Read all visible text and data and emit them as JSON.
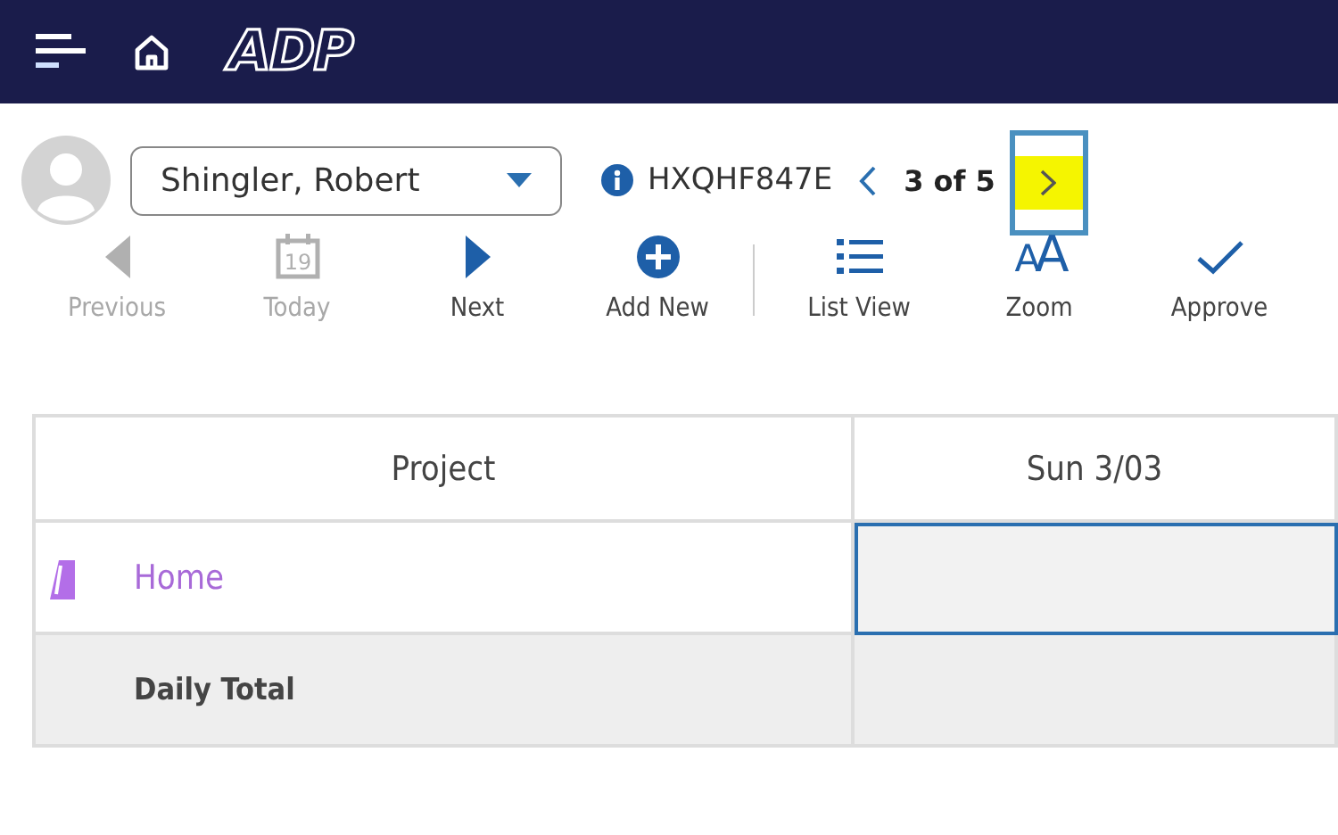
{
  "header": {
    "logo": "ADP"
  },
  "employee": {
    "name": "Shingler, Robert",
    "record_id": "HXQHF847E",
    "position": "3 of 5",
    "next_highlighted": true
  },
  "toolbar": {
    "groups": [
      [
        {
          "label": "Previous",
          "disabled": true
        },
        {
          "label": "Today",
          "disabled": true,
          "icon_text": "19"
        },
        {
          "label": "Next",
          "disabled": false
        },
        {
          "label": "Add New",
          "disabled": false
        }
      ],
      [
        {
          "label": "List View",
          "disabled": false
        },
        {
          "label": "Zoom",
          "disabled": false,
          "icon_text": "AA"
        },
        {
          "label": "Approve",
          "disabled": false
        }
      ]
    ]
  },
  "table": {
    "columns": [
      "Project",
      "Sun 3/03"
    ],
    "rows": [
      {
        "kind": "project",
        "project": "Home",
        "color": "#b36ee8",
        "selected": true
      },
      {
        "kind": "total",
        "project": "Daily Total",
        "selected": false
      }
    ]
  }
}
